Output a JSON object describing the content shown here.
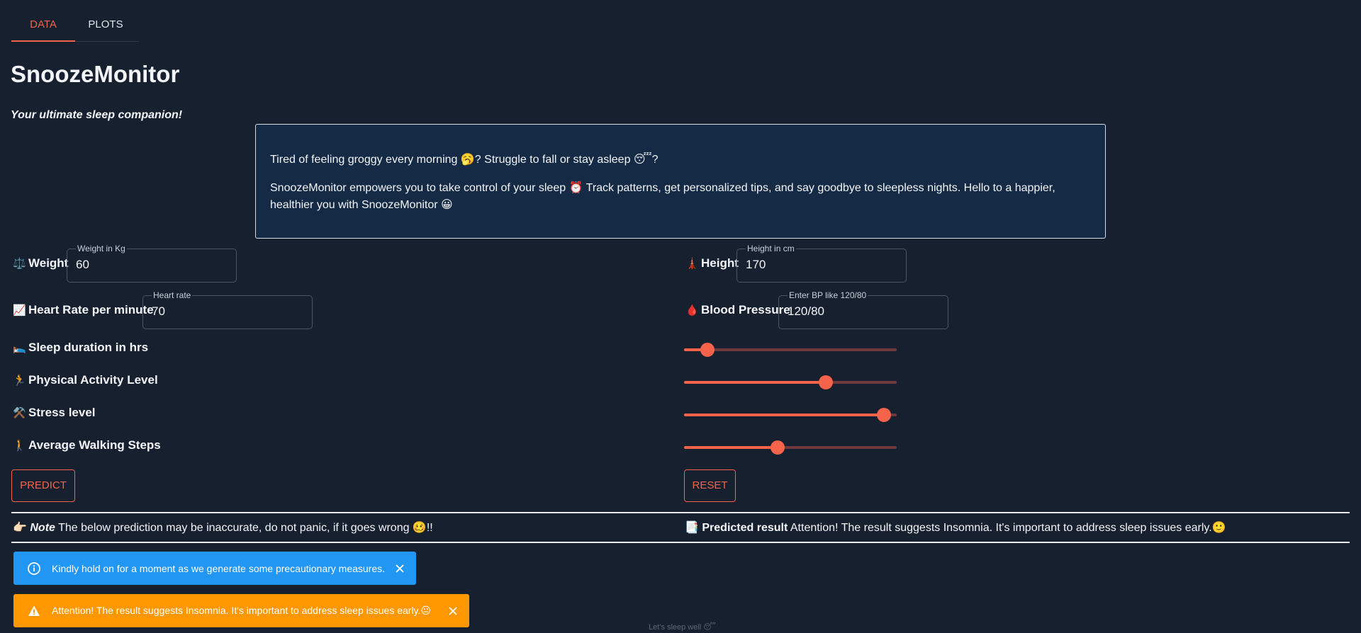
{
  "tabs": [
    {
      "label": "DATA",
      "active": true
    },
    {
      "label": "PLOTS",
      "active": false
    }
  ],
  "app": {
    "title": "SnoozeMonitor",
    "subtitle": "Your ultimate sleep companion!"
  },
  "intro": {
    "line1": "Tired of feeling groggy every morning 🥱? Struggle to fall or stay asleep 😴?",
    "line2": "SnoozeMonitor empowers you to take control of your sleep ⏰ Track patterns, get personalized tips, and say goodbye to sleepless nights. Hello to a happier, healthier you with SnoozeMonitor 😀"
  },
  "fields": {
    "weight": {
      "label": "Weight",
      "icon": "⚖️",
      "float_label": "Weight in Kg",
      "value": "60"
    },
    "height": {
      "label": "Height",
      "icon": "🗼",
      "float_label": "Height in cm",
      "value": "170"
    },
    "heart_rate": {
      "label": "Heart Rate per minute",
      "icon": "📈",
      "float_label": "Heart rate",
      "value": "70"
    },
    "blood_pressure": {
      "label": "Blood Pressure",
      "icon": "🩸",
      "float_label": "Enter BP like 120/80",
      "value": "120/80"
    }
  },
  "sliders": [
    {
      "label": "Sleep duration in hrs",
      "icon": "🛌",
      "fraction": 0.11
    },
    {
      "label": "Physical Activity Level",
      "icon": "🏃",
      "fraction": 0.665
    },
    {
      "label": "Stress level",
      "icon": "⚒️",
      "fraction": 0.94
    },
    {
      "label": "Average Walking Steps",
      "icon": "🚶",
      "fraction": 0.44
    }
  ],
  "buttons": {
    "predict": "PREDICT",
    "reset": "RESET"
  },
  "note": {
    "icon": "👉🏻",
    "title": "Note",
    "text": " The below prediction may be inaccurate, do not panic, if it goes wrong 🥴!!"
  },
  "result": {
    "icon": "📑",
    "title": "Predicted result",
    "text": " Attention! The result suggests Insomnia. It's important to address sleep issues early.🙂"
  },
  "alerts": {
    "info": "Kindly hold on for a moment as we generate some precautionary measures.",
    "warning": "Attention! The result suggests Insomnia. It's important to address sleep issues early.😐"
  },
  "footer": "Let's sleep well 😴",
  "colors": {
    "background": "#16202f",
    "accent": "#f4634a",
    "info": "#2196f3",
    "warning": "#ff9800"
  }
}
